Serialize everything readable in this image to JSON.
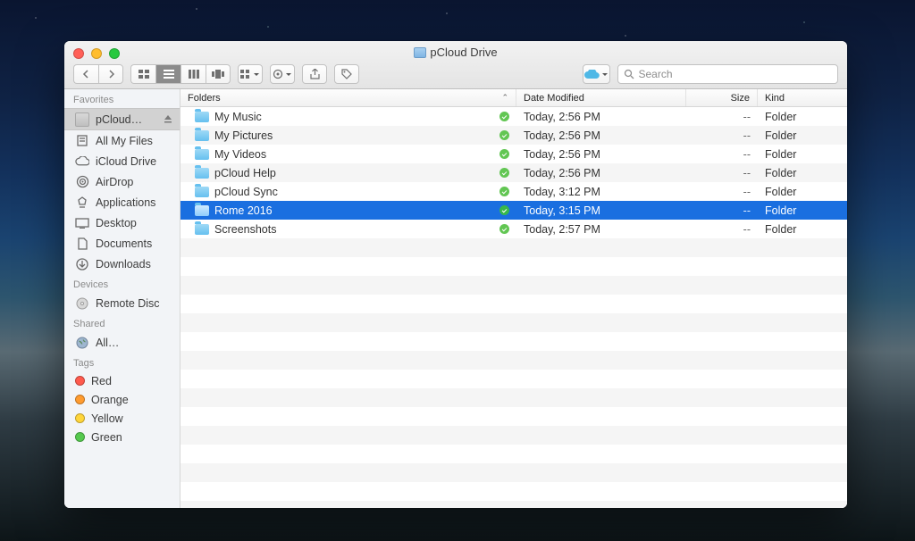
{
  "window": {
    "title": "pCloud Drive"
  },
  "toolbar": {
    "search_placeholder": "Search"
  },
  "sidebar": {
    "sections": [
      {
        "title": "Favorites",
        "items": [
          {
            "label": "pCloud…",
            "icon": "folder",
            "selected": true,
            "eject": true
          },
          {
            "label": "All My Files",
            "icon": "allfiles"
          },
          {
            "label": "iCloud Drive",
            "icon": "cloud"
          },
          {
            "label": "AirDrop",
            "icon": "airdrop"
          },
          {
            "label": "Applications",
            "icon": "apps"
          },
          {
            "label": "Desktop",
            "icon": "desktop"
          },
          {
            "label": "Documents",
            "icon": "docs"
          },
          {
            "label": "Downloads",
            "icon": "downloads"
          }
        ]
      },
      {
        "title": "Devices",
        "items": [
          {
            "label": "Remote Disc",
            "icon": "disc"
          }
        ]
      },
      {
        "title": "Shared",
        "items": [
          {
            "label": "All…",
            "icon": "globe"
          }
        ]
      },
      {
        "title": "Tags",
        "items": [
          {
            "label": "Red",
            "color": "#ff5a4d"
          },
          {
            "label": "Orange",
            "color": "#ff9b2f"
          },
          {
            "label": "Yellow",
            "color": "#ffd53a"
          },
          {
            "label": "Green",
            "color": "#55c94e"
          }
        ]
      }
    ]
  },
  "columns": {
    "name": "Folders",
    "date": "Date Modified",
    "size": "Size",
    "kind": "Kind"
  },
  "files": [
    {
      "name": "My Music",
      "date": "Today, 2:56 PM",
      "size": "--",
      "kind": "Folder",
      "synced": true
    },
    {
      "name": "My Pictures",
      "date": "Today, 2:56 PM",
      "size": "--",
      "kind": "Folder",
      "synced": true
    },
    {
      "name": "My Videos",
      "date": "Today, 2:56 PM",
      "size": "--",
      "kind": "Folder",
      "synced": true
    },
    {
      "name": "pCloud Help",
      "date": "Today, 2:56 PM",
      "size": "--",
      "kind": "Folder",
      "synced": true
    },
    {
      "name": "pCloud Sync",
      "date": "Today, 3:12 PM",
      "size": "--",
      "kind": "Folder",
      "synced": true
    },
    {
      "name": "Rome 2016",
      "date": "Today, 3:15 PM",
      "size": "--",
      "kind": "Folder",
      "synced": true,
      "selected": true
    },
    {
      "name": "Screenshots",
      "date": "Today, 2:57 PM",
      "size": "--",
      "kind": "Folder",
      "synced": true
    }
  ]
}
